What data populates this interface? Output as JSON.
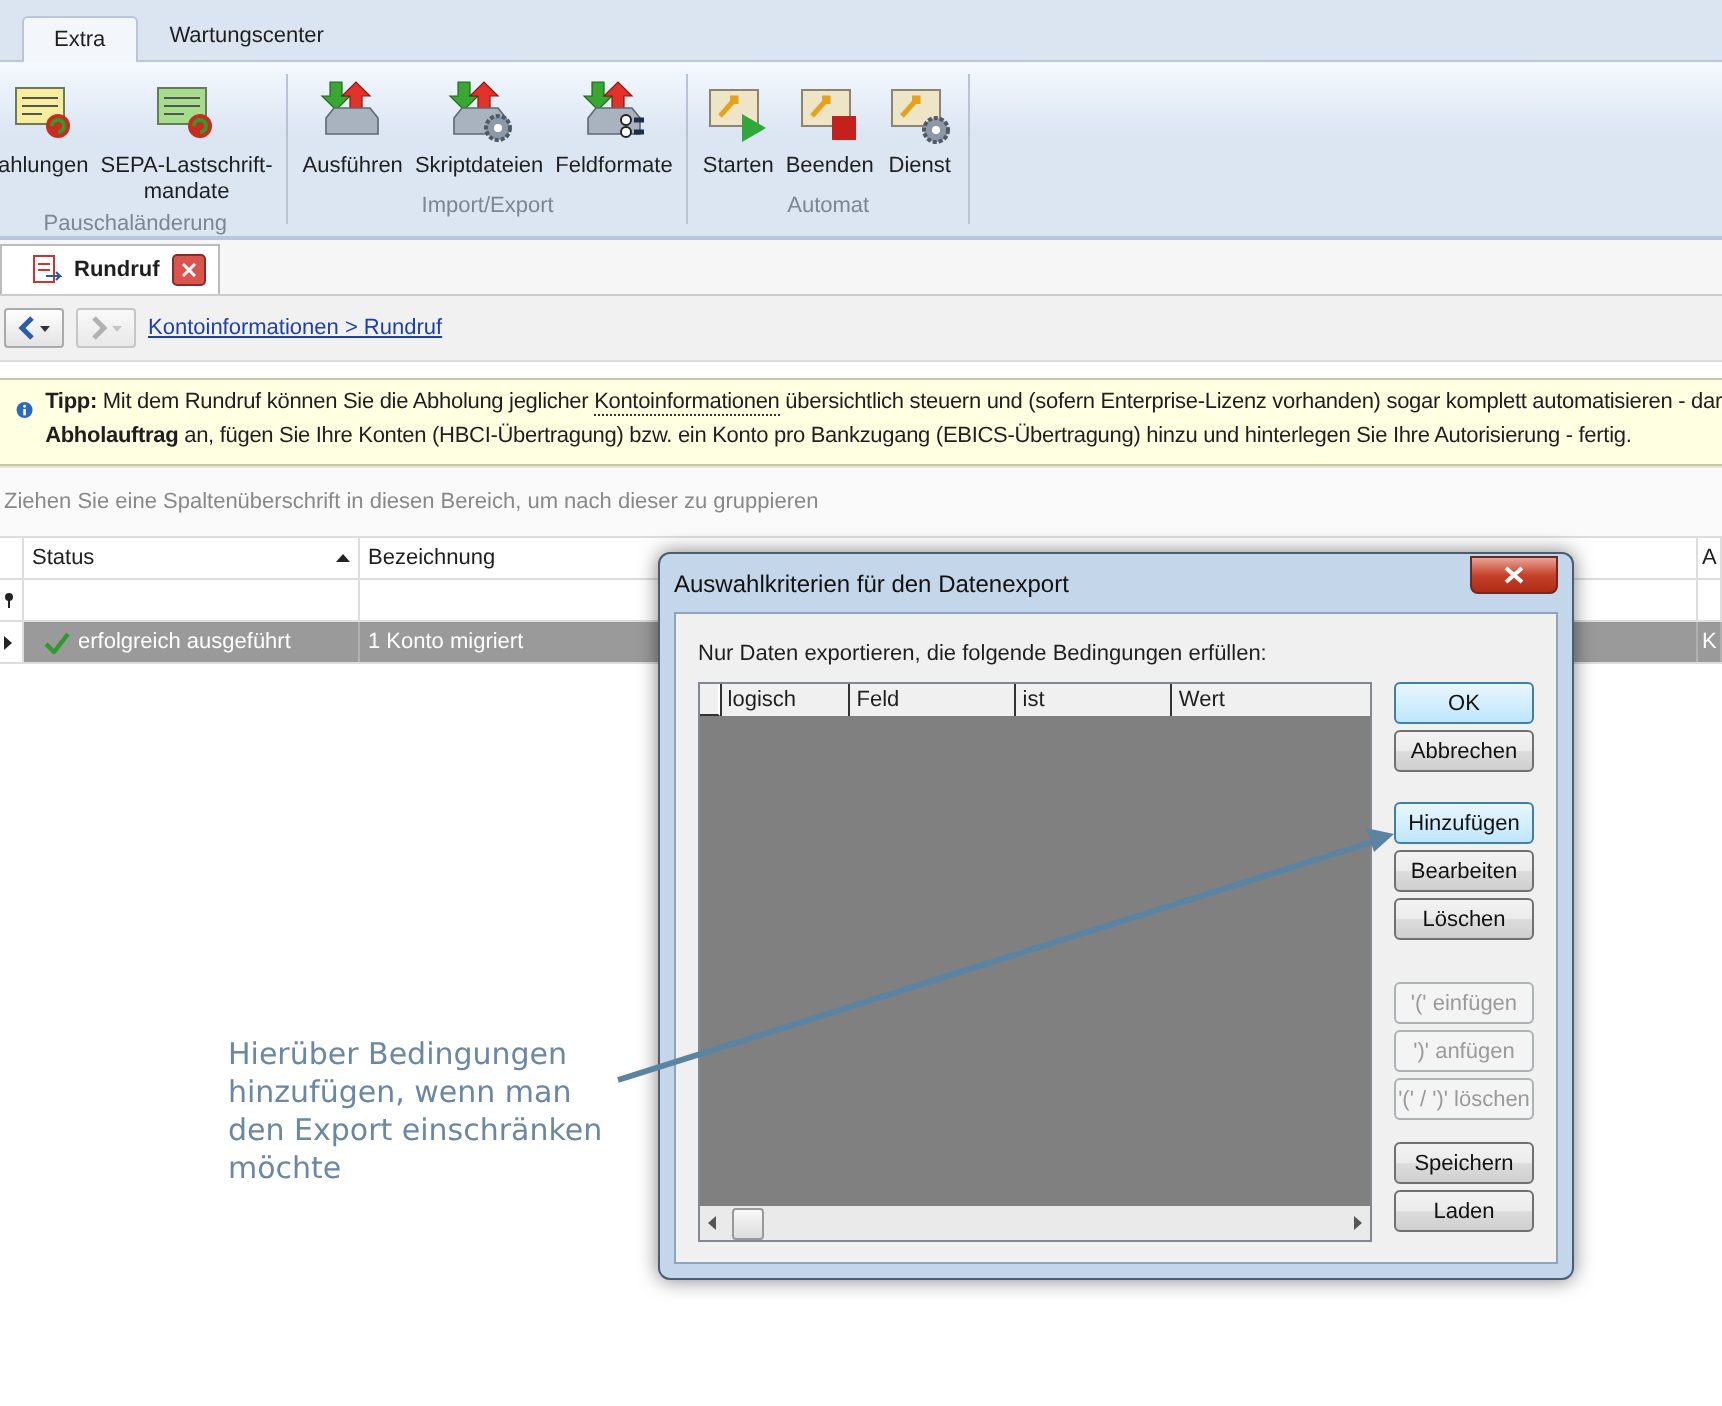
{
  "ribbon": {
    "tabs": [
      {
        "label": "Extra",
        "selected": true
      },
      {
        "label": "Wartungscenter",
        "selected": false
      }
    ],
    "groups": [
      {
        "label": "Pauschaländerung",
        "buttons": [
          {
            "label": "ahlungen"
          },
          {
            "label": "SEPA-Lastschrift-\nmandate"
          }
        ]
      },
      {
        "label": "Import/Export",
        "buttons": [
          {
            "label": "Ausführen"
          },
          {
            "label": "Skriptdateien"
          },
          {
            "label": "Feldformate"
          }
        ]
      },
      {
        "label": "Automat",
        "buttons": [
          {
            "label": "Starten"
          },
          {
            "label": "Beenden"
          },
          {
            "label": "Dienst"
          }
        ]
      }
    ]
  },
  "document_tab": {
    "label": "Rundruf"
  },
  "breadcrumb": "Kontoinformationen > Rundruf",
  "tip": {
    "label": "Tipp:",
    "text_1": " Mit dem Rundruf können Sie die Abholung jeglicher ",
    "link": "Kontoinformationen",
    "text_2": " übersichtlich steuern und (sofern Enterprise-Lizenz vorhanden) sogar komplett automatisieren - dar",
    "line_2": "**Abholauftrag** an, fügen Sie Ihre Konten (HBCI-Übertragung) bzw. ein Konto pro Bankzugang (EBICS-Übertragung) hinzu und hinterlegen Sie Ihre Autorisierung - fertig."
  },
  "group_panel_hint": "Ziehen Sie eine Spaltenüberschrift in diesen Bereich, um nach dieser zu gruppieren",
  "table": {
    "columns": [
      "Status",
      "Bezeichnung",
      "A"
    ],
    "rows": [
      {
        "selected": true,
        "cells": [
          "erfolgreich ausgeführt",
          "1 Konto migriert",
          "K"
        ]
      }
    ]
  },
  "dialog": {
    "title": "Auswahlkriterien für den Datenexport",
    "prompt": "Nur Daten exportieren, die folgende Bedingungen erfüllen:",
    "grid_columns": [
      "logisch",
      "Feld",
      "ist",
      "Wert"
    ],
    "buttons": [
      {
        "label": "OK",
        "highlighted": true,
        "disabled": false
      },
      {
        "label": "Abbrechen",
        "highlighted": false,
        "disabled": false
      },
      {
        "label": "Hinzufügen",
        "highlighted": true,
        "disabled": false
      },
      {
        "label": "Bearbeiten",
        "highlighted": false,
        "disabled": false
      },
      {
        "label": "Löschen",
        "highlighted": false,
        "disabled": false
      },
      {
        "label": "'(' einfügen",
        "highlighted": false,
        "disabled": true
      },
      {
        "label": "')' anfügen",
        "highlighted": false,
        "disabled": true
      },
      {
        "label": "'(' / ')' löschen",
        "highlighted": false,
        "disabled": true
      },
      {
        "label": "Speichern",
        "highlighted": false,
        "disabled": false
      },
      {
        "label": "Laden",
        "highlighted": false,
        "disabled": false
      }
    ]
  },
  "annotation": "Hierüber Bedingungen hinzufügen, wenn man den Export einschränken möchte"
}
